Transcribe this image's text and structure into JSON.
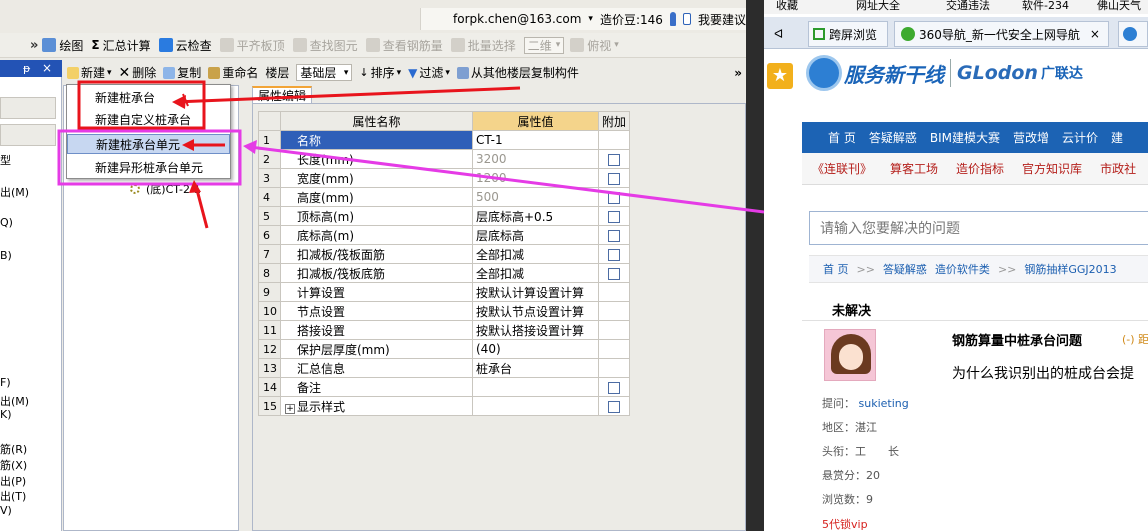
{
  "app": {
    "account_email": "forpk.chen@163.com",
    "account_caret": "▾",
    "beans": "造价豆:146",
    "suggest": "我要建议",
    "overflow": "»"
  },
  "toolbar1": {
    "draw": "绘图",
    "sum": "汇总计算",
    "cloud_check": "云检查",
    "level_slab": "平齐板顶",
    "find": "查找图元",
    "view_rebar": "查看钢筋量",
    "batch_select": "批量选择",
    "view_mode": "二维",
    "view_angle": "俯视",
    "sum_glyph": "Σ"
  },
  "left_panel": {
    "pin": "ᵽ",
    "close": "×",
    "items": [
      "型",
      "出(M)",
      "Q)",
      "B)",
      "F)",
      "出(M)",
      "K)",
      "筋(R)",
      "筋(X)",
      "出(P)",
      "出(T)",
      "V)"
    ]
  },
  "toolbar2": {
    "new": "新建",
    "delete": "删除",
    "copy": "复制",
    "rename": "重命名",
    "floor_label": "楼层",
    "floor_value": "基础层",
    "sort": "排序",
    "filter": "过滤",
    "copy_from_floor": "从其他楼层复制构件",
    "overflow": "»"
  },
  "new_menu": {
    "items": [
      "新建桩承台",
      "新建自定义桩承台",
      "新建桩承台单元",
      "新建异形桩承台单元"
    ]
  },
  "tree": {
    "item": "(底)CT-2-1"
  },
  "prop_panel": {
    "tab": "属性编辑",
    "headers": {
      "name": "属性名称",
      "value": "属性值",
      "extra": "附加"
    },
    "rows": [
      {
        "no": "1",
        "name": "名称",
        "value": "CT-1"
      },
      {
        "no": "2",
        "name": "长度(mm)",
        "value": "3200"
      },
      {
        "no": "3",
        "name": "宽度(mm)",
        "value": "1200"
      },
      {
        "no": "4",
        "name": "高度(mm)",
        "value": "500"
      },
      {
        "no": "5",
        "name": "顶标高(m)",
        "value": "层底标高+0.5"
      },
      {
        "no": "6",
        "name": "底标高(m)",
        "value": "层底标高"
      },
      {
        "no": "7",
        "name": "扣减板/筏板面筋",
        "value": "全部扣减"
      },
      {
        "no": "8",
        "name": "扣减板/筏板底筋",
        "value": "全部扣减"
      },
      {
        "no": "9",
        "name": "计算设置",
        "value": "按默认计算设置计算"
      },
      {
        "no": "10",
        "name": "节点设置",
        "value": "按默认节点设置计算"
      },
      {
        "no": "11",
        "name": "搭接设置",
        "value": "按默认搭接设置计算"
      },
      {
        "no": "12",
        "name": "保护层厚度(mm)",
        "value": "(40)"
      },
      {
        "no": "13",
        "name": "汇总信息",
        "value": "桩承台"
      },
      {
        "no": "14",
        "name": "备注",
        "value": ""
      },
      {
        "no": "15",
        "name": "显示样式",
        "value": ""
      }
    ],
    "expand_glyph": "+"
  },
  "browser": {
    "bookmarks": [
      "收藏",
      "网址大全",
      "交通违法",
      "软件-234",
      "佛山天气"
    ],
    "tabs": [
      "跨屏浏览",
      "360导航_新一代安全上网导航",
      "×"
    ],
    "back": "ᐊ",
    "star": "★",
    "logo_cn": "服务新干线",
    "logo_en": "GLodon",
    "logo_cn2": "广联达",
    "nav1": [
      "首 页",
      "答疑解惑",
      "BIM建模大赛",
      "营改增",
      "云计价",
      "建"
    ],
    "nav2": [
      "《连联刊》",
      "算客工场",
      "造价指标",
      "官方知识库",
      "市政社"
    ],
    "search_placeholder": "请输入您要解决的问题",
    "crumbs": [
      "首 页",
      ">>",
      "答疑解惑",
      "造价软件类",
      ">>",
      "钢筋抽样GGJ2013"
    ],
    "question": {
      "status": "未解决",
      "title": "钢筋算量中桩承台问题",
      "reply_tag": "(-) 距",
      "body": "为什么我识别出的桩成台会提",
      "asker_label": "提问：",
      "asker": "sukieting",
      "region": "地区：湛江",
      "title_label": "头衔：工　　长",
      "bounty": "悬赏分：20",
      "views": "浏览数：9",
      "vip": "5代锁vip"
    }
  },
  "colors": {
    "selection_blue": "#2f5fb8",
    "value_header_orange": "#f4d48b",
    "annotation_red": "#e8141c",
    "annotation_magenta": "#e53be6",
    "nav_blue": "#1c63b4"
  }
}
